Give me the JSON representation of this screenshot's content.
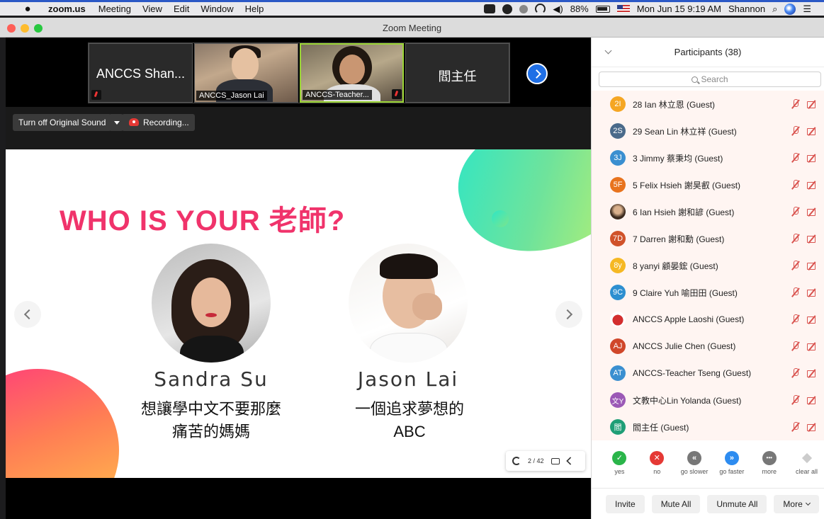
{
  "menubar": {
    "app": "zoom.us",
    "menus": [
      "Meeting",
      "View",
      "Edit",
      "Window",
      "Help"
    ],
    "battery": "88%",
    "datetime": "Mon Jun 15  9:19 AM",
    "user": "Shannon"
  },
  "window": {
    "title": "Zoom Meeting"
  },
  "filmstrip": {
    "tiles": [
      {
        "big_text": "ANCCS Shan...",
        "muted": true
      },
      {
        "name": "ANCCS_Jason Lai"
      },
      {
        "name": "ANCCS-Teacher...",
        "muted": true
      },
      {
        "big_text": "閻主任",
        "muted": true
      }
    ]
  },
  "controls": {
    "original_sound": "Turn off Original Sound",
    "recording": "Recording..."
  },
  "slide": {
    "title": "WHO IS YOUR 老師?",
    "people": [
      {
        "name": "Sandra Su",
        "desc_line1": "想讓學中文不要那麼",
        "desc_line2": "痛苦的媽媽"
      },
      {
        "name": "Jason Lai",
        "desc_line1": "一個追求夢想的",
        "desc_line2": "ABC"
      }
    ],
    "page_indicator": "2 / 42"
  },
  "participants": {
    "title": "Participants (38)",
    "search_placeholder": "Search",
    "items": [
      {
        "initials": "2I",
        "name": "28 Ian 林立恩 (Guest)",
        "color": "#f5a623"
      },
      {
        "initials": "2S",
        "name": "29 Sean Lin 林立祥 (Guest)",
        "color": "#4a6a8a"
      },
      {
        "initials": "3J",
        "name": "3 Jimmy 蔡秉均 (Guest)",
        "color": "#3a8fd0"
      },
      {
        "initials": "5F",
        "name": "5 Felix Hsieh 謝昊叡 (Guest)",
        "color": "#e8731d"
      },
      {
        "initials": "",
        "name": "6 Ian Hsieh 謝和諺 (Guest)",
        "color": "#6b5a4a"
      },
      {
        "initials": "7D",
        "name": "7 Darren 謝和勳 (Guest)",
        "color": "#d0522a"
      },
      {
        "initials": "8y",
        "name": "8 yanyi 顧晏鋐 (Guest)",
        "color": "#f5b823"
      },
      {
        "initials": "9C",
        "name": "9 Claire Yuh 喻田田 (Guest)",
        "color": "#2d8fd0"
      },
      {
        "initials": "",
        "name": "ANCCS Apple Laoshi (Guest)",
        "color": "#d32f2f"
      },
      {
        "initials": "AJ",
        "name": "ANCCS Julie Chen (Guest)",
        "color": "#d0472a"
      },
      {
        "initials": "AT",
        "name": "ANCCS-Teacher Tseng (Guest)",
        "color": "#3a8fd0"
      },
      {
        "initials": "文Y",
        "name": "文教中心Lin Yolanda (Guest)",
        "color": "#9b59b6"
      },
      {
        "initials": "閻",
        "name": "閻主任 (Guest)",
        "color": "#1f9e76"
      }
    ],
    "reactions": [
      {
        "label": "yes",
        "glyph": "✓",
        "color": "#2ab54a"
      },
      {
        "label": "no",
        "glyph": "✕",
        "color": "#e53935"
      },
      {
        "label": "go slower",
        "glyph": "«",
        "color": "#777777"
      },
      {
        "label": "go faster",
        "glyph": "»",
        "color": "#2d8cf0"
      },
      {
        "label": "more",
        "glyph": "•••",
        "color": "#777777"
      },
      {
        "label": "clear all",
        "glyph": "",
        "color": "#cccccc"
      }
    ],
    "buttons": {
      "invite": "Invite",
      "mute_all": "Mute All",
      "unmute_all": "Unmute All",
      "more": "More"
    }
  }
}
